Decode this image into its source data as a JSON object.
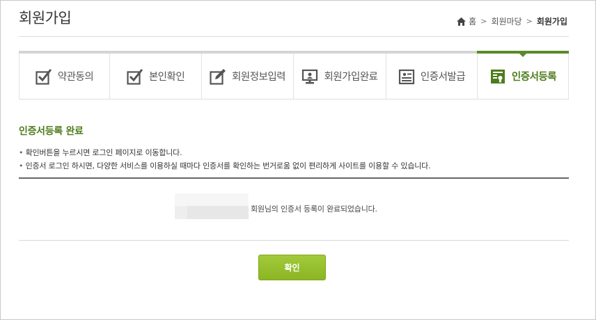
{
  "page": {
    "title": "회원가입"
  },
  "breadcrumb": {
    "home": "홈",
    "level1": "회원마당",
    "current": "회원가입"
  },
  "steps": [
    {
      "label": "약관동의",
      "icon": "checkbox-icon",
      "active": false
    },
    {
      "label": "본인확인",
      "icon": "checkbox-icon",
      "active": false
    },
    {
      "label": "회원정보입력",
      "icon": "edit-icon",
      "active": false
    },
    {
      "label": "회원가입완료",
      "icon": "computer-icon",
      "active": false
    },
    {
      "label": "인증서발급",
      "icon": "id-card-icon",
      "active": false
    },
    {
      "label": "인증서등록",
      "icon": "certificate-icon",
      "active": true
    }
  ],
  "section": {
    "title": "인증서등록 완료",
    "notes": [
      "확인버튼을 누르시면 로그인 페이지로 이동합니다.",
      "인증서 로그인 하시면, 다양한 서비스를 이용하실 때마다 인증서를 확인하는 번거로움 없이 편리하게 사이트를 이용할 수 있습니다."
    ]
  },
  "result": {
    "message": "회원님의 인증서 등록이 완료되었습니다."
  },
  "buttons": {
    "confirm": "확인"
  },
  "colors": {
    "accent_green": "#5a8a28",
    "button_green": "#97c02e"
  }
}
